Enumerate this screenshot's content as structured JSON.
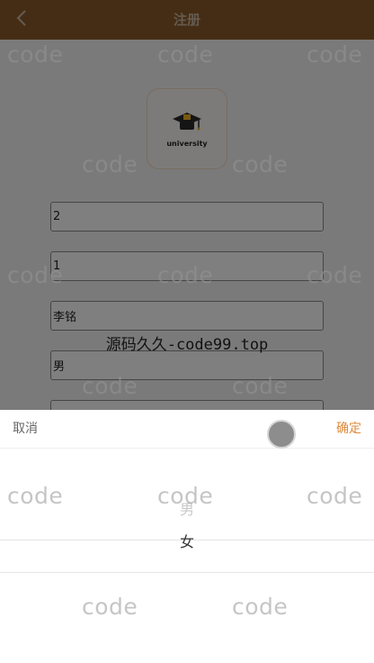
{
  "header": {
    "title": "注册",
    "back_icon": "chevron-left-icon"
  },
  "logo": {
    "icon": "graduation-cap-icon",
    "wordmark": "university"
  },
  "form": {
    "fields": [
      {
        "value": "2"
      },
      {
        "value": "1"
      },
      {
        "value": "李铭"
      },
      {
        "value": "男"
      },
      {
        "value": ""
      }
    ]
  },
  "watermark": {
    "text": "code",
    "center_text": "源码久久-code99.top"
  },
  "picker": {
    "cancel_label": "取消",
    "confirm_label": "确定",
    "options": [
      "男",
      "女"
    ],
    "selected": "女"
  },
  "colors": {
    "header_bg": "#8a5a2b",
    "accent": "#e08a3c"
  }
}
